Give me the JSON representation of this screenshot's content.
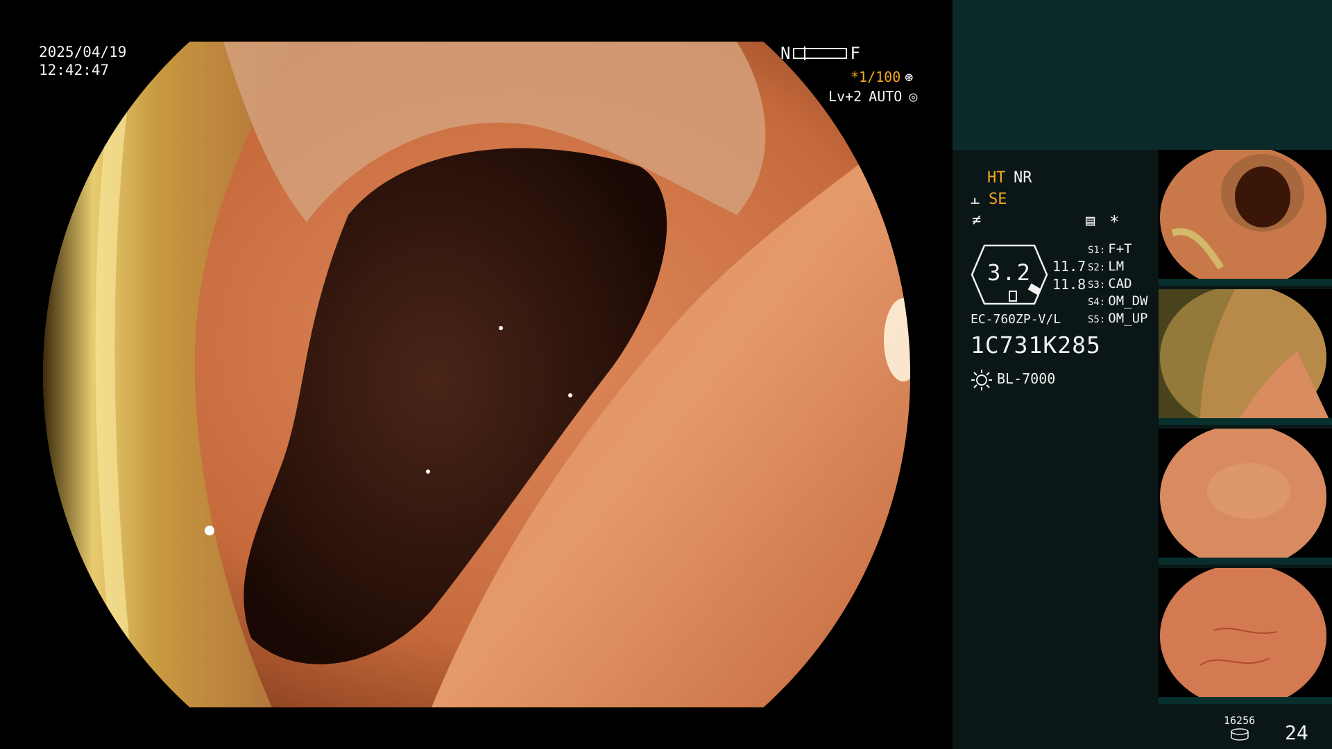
{
  "osd": {
    "date": "2025/04/19",
    "time": "12:42:47",
    "nf_left": "N",
    "nf_right": "F",
    "shutter": "*1/100",
    "level": "Lv+2",
    "mode": "AUTO"
  },
  "panel": {
    "ht": "HT",
    "nr": "NR",
    "se": "SE",
    "star": "*",
    "gauge_value": "3.2",
    "value1": "11.7",
    "value2": "11.8",
    "settings": [
      {
        "key": "S1:",
        "value": "F+T"
      },
      {
        "key": "S2:",
        "value": "LM"
      },
      {
        "key": "S3:",
        "value": "CAD"
      },
      {
        "key": "S4:",
        "value": "OM_DW"
      },
      {
        "key": "S5:",
        "value": "OM_UP"
      }
    ],
    "model": "EC-760ZP-V/L",
    "serial": "1C731K285",
    "light_source": "BL-7000"
  },
  "footer": {
    "disk_count": "16256",
    "page": "24"
  },
  "colors": {
    "accent_orange": "#f5a623",
    "panel_teal": "#0d2a2a",
    "panel_dark": "#0a1716"
  }
}
